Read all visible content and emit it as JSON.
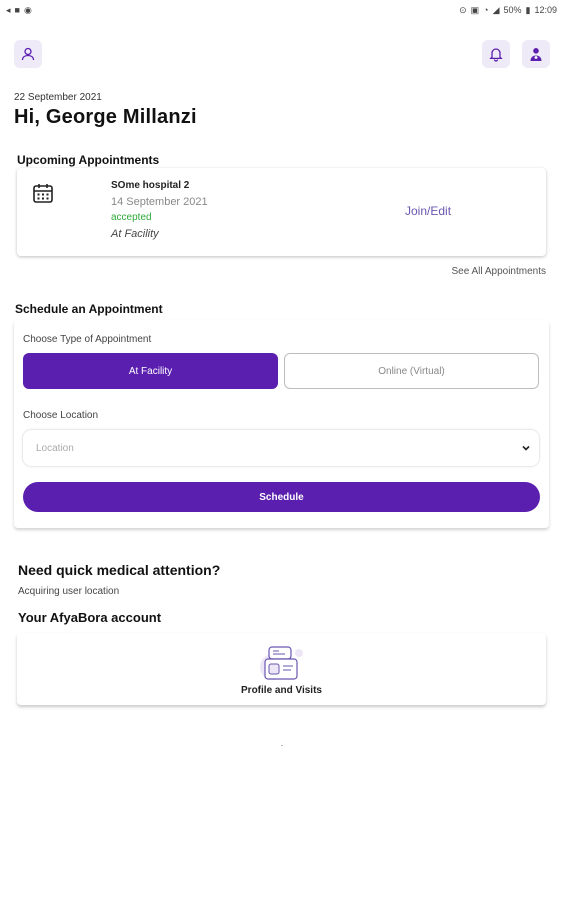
{
  "status_bar": {
    "battery": "50%",
    "time": "12:09"
  },
  "header": {
    "date": "22 September 2021",
    "greeting": "Hi, George Millanzi"
  },
  "upcoming": {
    "title": "Upcoming Appointments",
    "appointment": {
      "hospital": "SOme hospital 2",
      "date": "14 September 2021",
      "status": "accepted",
      "type": "At Facility",
      "action": "Join/Edit"
    },
    "see_all": "See All Appointments"
  },
  "schedule": {
    "title": "Schedule an Appointment",
    "type_label": "Choose Type of Appointment",
    "type_options": [
      "At Facility",
      "Online (Virtual)"
    ],
    "selected_type": "At Facility",
    "location_label": "Choose Location",
    "location_placeholder": "Location",
    "submit_label": "Schedule"
  },
  "quick": {
    "title": "Need quick medical attention?",
    "subtitle": "Acquiring user location"
  },
  "account": {
    "title": "Your AfyaBora account",
    "profile_label": "Profile and Visits"
  },
  "colors": {
    "primary": "#5b1fb0",
    "accent_light": "#efeaf7",
    "status_accepted": "#2eaa3a",
    "link": "#6a56b0"
  },
  "icons": [
    "user-icon",
    "bell-icon",
    "doctor-icon",
    "calendar-icon",
    "chevron-down-icon",
    "profile-visits-illustration"
  ]
}
